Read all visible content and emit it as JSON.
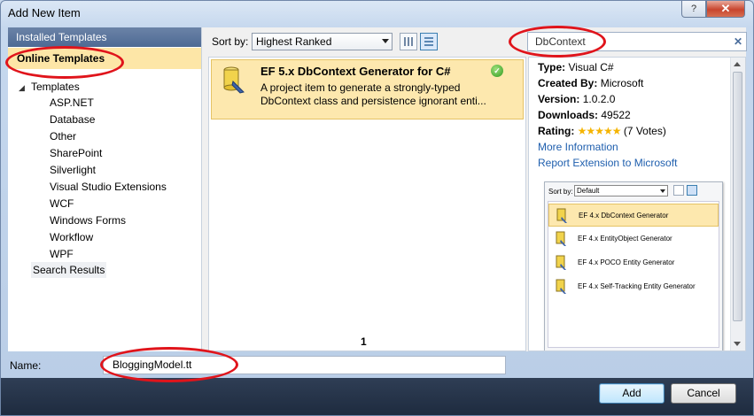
{
  "window": {
    "title": "Add New Item",
    "help_label": "?",
    "close_label": "✕"
  },
  "nav": {
    "installed": "Installed Templates",
    "online": "Online Templates",
    "templates_root": "Templates",
    "items": [
      "ASP.NET",
      "Database",
      "Other",
      "SharePoint",
      "Silverlight",
      "Visual Studio Extensions",
      "WCF",
      "Windows Forms",
      "Workflow",
      "WPF"
    ],
    "search_results": "Search Results"
  },
  "toolbar": {
    "sort_label": "Sort by:",
    "sort_value": "Highest Ranked"
  },
  "search": {
    "value": "DbContext",
    "clear_label": "✕"
  },
  "results": [
    {
      "title": "EF 5.x DbContext Generator for C#",
      "description": "A project item to generate a strongly-typed DbContext class and persistence ignorant enti..."
    }
  ],
  "page_number": "1",
  "details": {
    "type_label": "Type:",
    "type_value": "Visual C#",
    "created_label": "Created By:",
    "created_value": "Microsoft",
    "version_label": "Version:",
    "version_value": "1.0.2.0",
    "downloads_label": "Downloads:",
    "downloads_value": "49522",
    "rating_label": "Rating:",
    "rating_stars": "★★★★★",
    "rating_votes": "(7 Votes)",
    "more_info": "More Information",
    "report": "Report Extension to Microsoft"
  },
  "preview": {
    "sort_label": "Sort by:",
    "sort_value": "Default",
    "items": [
      "EF 4.x DbContext Generator",
      "EF 4.x EntityObject Generator",
      "EF 4.x POCO Entity Generator",
      "EF 4.x Self-Tracking Entity Generator"
    ]
  },
  "name": {
    "label": "Name:",
    "value": "BloggingModel.tt"
  },
  "buttons": {
    "add": "Add",
    "cancel": "Cancel"
  },
  "colors": {
    "annotation": "#e0141b",
    "selection": "#fde8ae",
    "link": "#1f5fae",
    "header": "#4e6a94"
  }
}
